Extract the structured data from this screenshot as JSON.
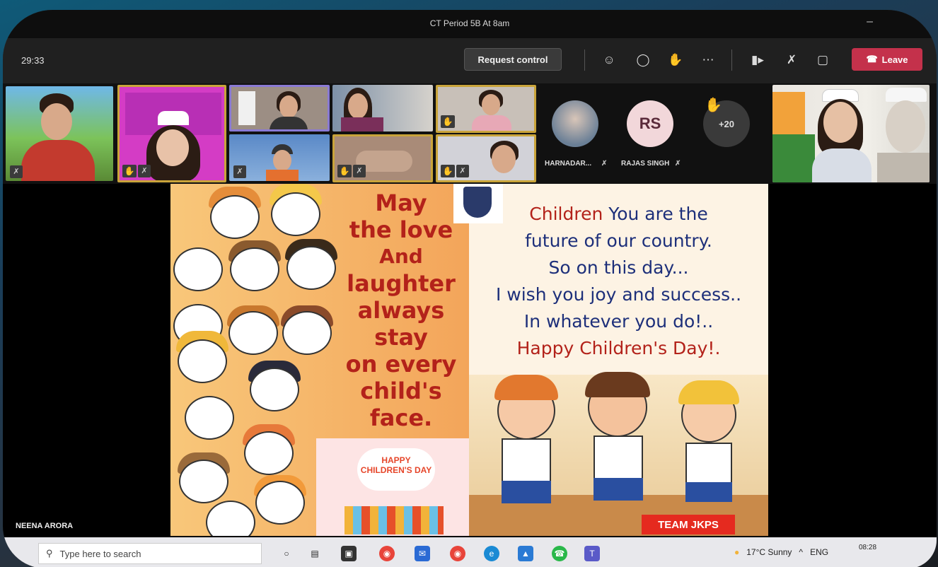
{
  "meeting": {
    "title": "CT Period 5B At 8am",
    "timer": "29:33",
    "request_control": "Request control",
    "leave": "Leave"
  },
  "toolbar_icons": [
    "participants-icon",
    "chat-icon",
    "raise-hand-icon",
    "more-icon",
    "camera-icon",
    "mic-muted-icon",
    "share-icon"
  ],
  "participants": [
    {
      "name": "HARNADAR...",
      "initials": ""
    },
    {
      "name": "RAJAS SINGH",
      "initials": "RS"
    }
  ],
  "overflow_count": "+20",
  "presenter_name": "NEENA ARORA",
  "slide": {
    "poem": [
      "May",
      "the love",
      "And",
      "laughter",
      "always",
      "stay",
      "on every",
      "child's",
      "face."
    ],
    "message": [
      "Children You are the",
      "future of our country.",
      "So on this day...",
      "I wish you joy and success..",
      "In whatever you do!..",
      "Happy Children's Day!."
    ],
    "badge": "TEAM JKPS",
    "mini_card": "HAPPY CHILDREN'S DAY"
  },
  "taskbar": {
    "search_placeholder": "Type here to search",
    "weather": "17°C  Sunny",
    "lang": "ENG",
    "time": "08:28"
  },
  "colors": {
    "leave": "#c4314b",
    "accent_highlight": "#c9a43a",
    "poem_red": "#b3221a"
  }
}
